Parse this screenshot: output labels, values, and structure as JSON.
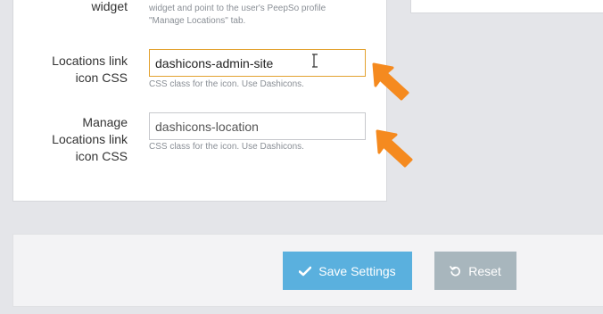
{
  "top_row": {
    "label": "widget",
    "help_line1": "widget and point to the user's PeepSo profile",
    "help_line2": "\"Manage Locations\" tab."
  },
  "locations_link_icon": {
    "label_line1": "Locations link",
    "label_line2": "icon CSS",
    "value": "dashicons-admin-site",
    "help": "CSS class for the icon. Use Dashicons."
  },
  "manage_locations_icon": {
    "label_line1": "Manage",
    "label_line2": "Locations link",
    "label_line3": "icon CSS",
    "value": "dashicons-location",
    "help": "CSS class for the icon. Use Dashicons."
  },
  "footer": {
    "save_label": "Save Settings",
    "reset_label": "Reset"
  },
  "colors": {
    "save_button": "#5ab0de",
    "reset_button": "#a8b6bd",
    "arrow": "#f58a1f",
    "active_field_border": "#e3a230"
  },
  "icons": [
    "check-icon",
    "undo-icon",
    "text-cursor-icon",
    "arrow-pointer-icon"
  ]
}
